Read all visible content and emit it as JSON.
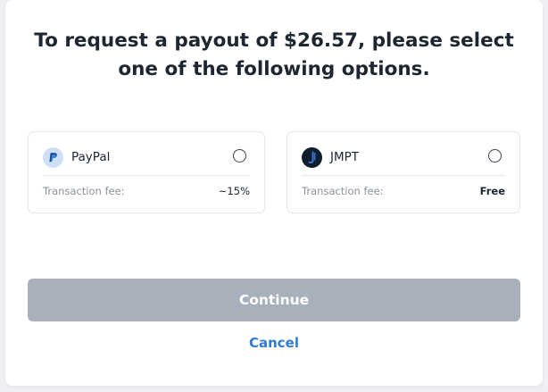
{
  "dialog": {
    "title_line1": "To request a payout of $26.57, please select",
    "title_line2": "one of the following options."
  },
  "options": [
    {
      "name": "PayPal",
      "icon": "paypal-icon",
      "fee_label": "Transaction fee:",
      "fee_value": "~15%",
      "selected": false
    },
    {
      "name": "JMPT",
      "icon": "jmpt-icon",
      "fee_label": "Transaction fee:",
      "fee_value": "Free",
      "selected": false
    }
  ],
  "actions": {
    "continue_label": "Continue",
    "cancel_label": "Cancel"
  },
  "colors": {
    "continue_disabled_bg": "#a8b1bb",
    "cancel_link": "#2e7bd6",
    "card_border": "#e3e6ea"
  }
}
